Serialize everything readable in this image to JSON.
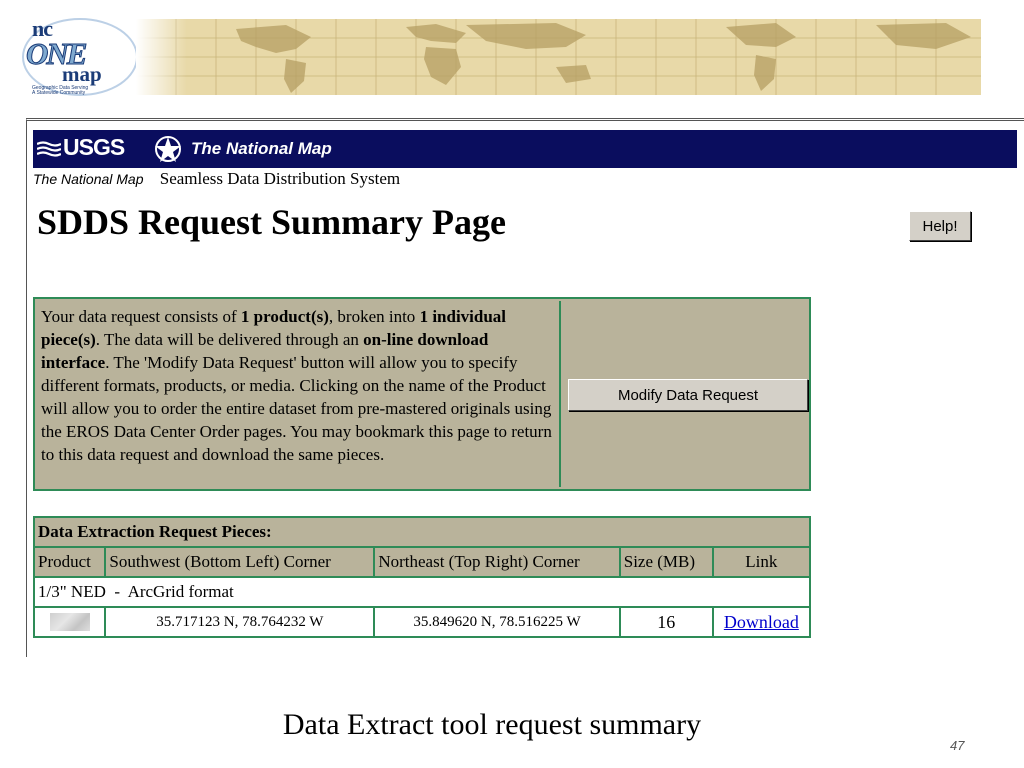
{
  "banner": {
    "logo_nc": "nc",
    "logo_one": "ONE",
    "logo_map": "map",
    "logo_tagline_1": "Geographic Data Serving",
    "logo_tagline_2": "A Statewide Community"
  },
  "header": {
    "usgs_logo": "USGS",
    "title": "The National Map",
    "subtitle_small": "The National Map",
    "subtitle": "Seamless Data Distribution System",
    "bar_color": "#0a0d5e"
  },
  "page": {
    "title": "SDDS Request Summary Page",
    "help_label": "Help!"
  },
  "info": {
    "t1": "Your data request consists of ",
    "b1": "1 product(s)",
    "t2": ", broken into ",
    "b2": "1 individual piece(s)",
    "t3": ". The data will be delivered through an ",
    "b3": "on-line download interface",
    "t4": ". The 'Modify Data Request' button will allow you to specify different formats, products, or media. Clicking on the name of the Product will allow you to order the entire dataset from pre-mastered originals using the EROS Data Center Order pages. You may bookmark this page to return to this data request and download the same pieces.",
    "modify_label": "Modify Data Request"
  },
  "pieces": {
    "title": "Data Extraction Request Pieces:",
    "columns": [
      "Product",
      "Southwest (Bottom Left) Corner",
      "Northeast (Top Right) Corner",
      "Size (MB)",
      "Link"
    ],
    "product_name": "1/3\" NED  -  ArcGrid format",
    "rows": [
      {
        "sw": "35.717123 N, 78.764232 W",
        "ne": "35.849620 N, 78.516225 W",
        "size": "16",
        "link": "Download"
      }
    ]
  },
  "caption": "Data Extract tool request summary",
  "slide_number": "47",
  "colors": {
    "table_border": "#2e8b57",
    "table_fill": "#b9b39b",
    "link": "#0000cc"
  }
}
